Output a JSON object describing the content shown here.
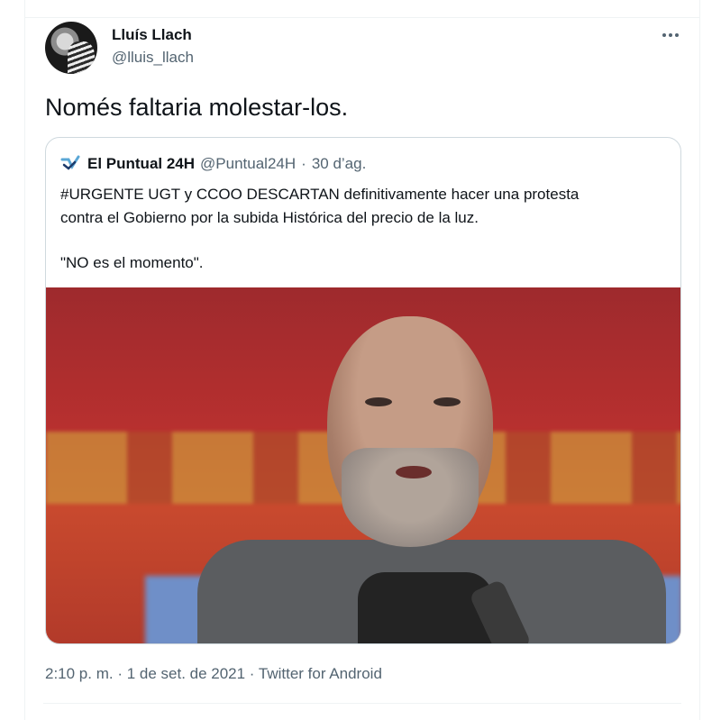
{
  "tweet": {
    "author_name": "Lluís Llach",
    "author_handle": "@lluis_llach",
    "text": "Només faltaria molestar-los.",
    "timestamp": "2:10 p. m. · 1 de set. de 2021 · Twitter for Android",
    "more_icon": "ellipsis-icon"
  },
  "quote": {
    "author_name": "El Puntual 24H",
    "author_handle": "@Puntual24H",
    "separator": "·",
    "date": "30 d’ag.",
    "body_line1": "#URGENTE UGT y CCOO DESCARTAN definitivamente hacer una protesta",
    "body_line2": "contra el Gobierno por la subida Histórica del precio de la luz.",
    "body_line3": "\"NO es el momento\".",
    "logo_icon": "puntual-logo-icon"
  },
  "colors": {
    "text_primary": "#0f1419",
    "text_secondary": "#536471",
    "border": "#cfd9de"
  }
}
